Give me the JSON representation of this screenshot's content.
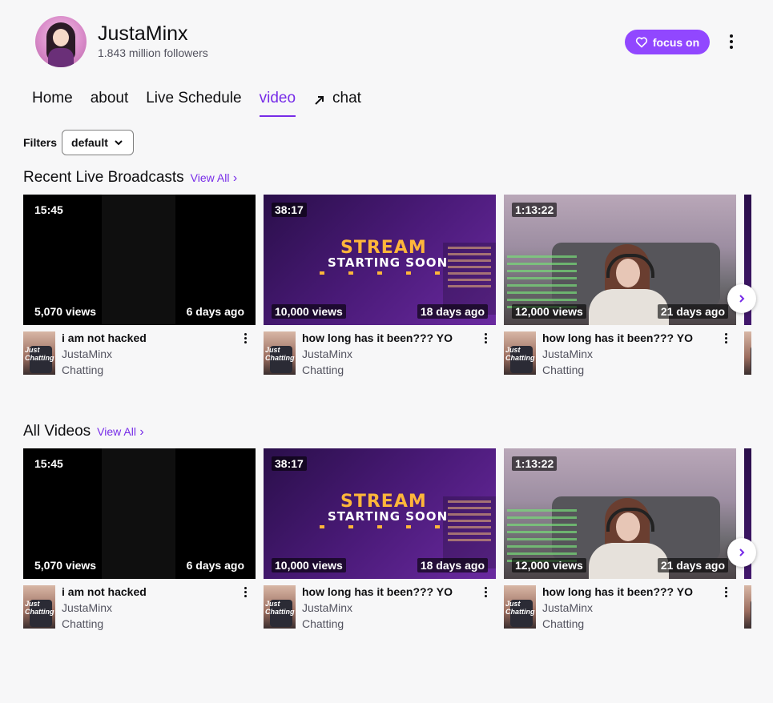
{
  "channel": {
    "name": "JustaMinx",
    "followers": "1.843 million followers",
    "follow_label": "focus on"
  },
  "colors": {
    "accent": "#9147ff",
    "accent_text": "#772ce8"
  },
  "tabs": [
    {
      "label": "Home"
    },
    {
      "label": "about"
    },
    {
      "label": "Live Schedule"
    },
    {
      "label": "video",
      "active": true
    },
    {
      "label": "chat",
      "icon": "external-arrow-icon"
    }
  ],
  "filters": {
    "label": "Filters",
    "selected": "default"
  },
  "sections": [
    {
      "title": "Recent Live Broadcasts",
      "view_all": "View All",
      "videos": [
        {
          "duration": "15:45",
          "views": "5,070 views",
          "age": "6 days ago",
          "title": "i am not hacked",
          "channel": "JustaMinx",
          "category": "Chatting",
          "thumb": "black"
        },
        {
          "duration": "38:17",
          "views": "10,000 views",
          "age": "18 days ago",
          "title": "how long has it been??? YO",
          "channel": "JustaMinx",
          "category": "Chatting",
          "thumb": "stream"
        },
        {
          "duration": "1:13:22",
          "views": "12,000 views",
          "age": "21 days ago",
          "title": "how long has it been??? YO",
          "channel": "JustaMinx",
          "category": "Chatting",
          "thumb": "room"
        }
      ]
    },
    {
      "title": "All Videos",
      "view_all": "View All",
      "videos": [
        {
          "duration": "15:45",
          "views": "5,070 views",
          "age": "6 days ago",
          "title": "i am not hacked",
          "channel": "JustaMinx",
          "category": "Chatting",
          "thumb": "black"
        },
        {
          "duration": "38:17",
          "views": "10,000 views",
          "age": "18 days ago",
          "title": "how long has it been??? YO",
          "channel": "JustaMinx",
          "category": "Chatting",
          "thumb": "stream"
        },
        {
          "duration": "1:13:22",
          "views": "12,000 views",
          "age": "21 days ago",
          "title": "how long has it been??? YO",
          "channel": "JustaMinx",
          "category": "Chatting",
          "thumb": "room"
        }
      ]
    }
  ],
  "thumb_text": {
    "stream_line1": "STREAM",
    "stream_line2": "STARTING SOON",
    "small_thumb": "Just Chatting"
  }
}
